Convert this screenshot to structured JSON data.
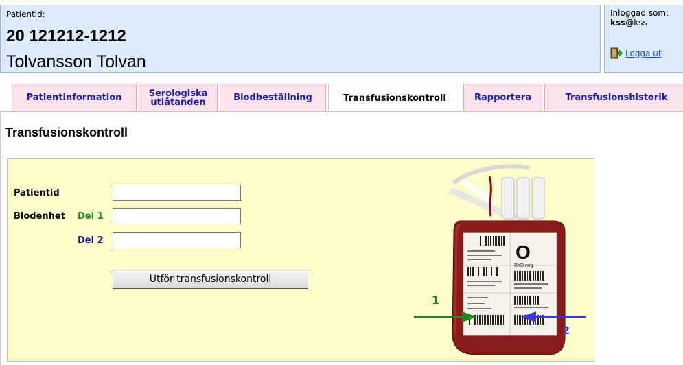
{
  "header": {
    "patient_id_label": "Patientid:",
    "patient_id": "20 121212-1212",
    "patient_name": "Tolvansson Tolvan",
    "login_label": "Inloggad som:",
    "login_user_bold": "kss",
    "login_user_domain": "@kss",
    "logout_link": "Logga ut",
    "logout_icon": "exit-door-icon"
  },
  "tabs": [
    {
      "label": "Patientinformation",
      "active": false
    },
    {
      "label": "Serologiska\nutlåtanden",
      "active": false
    },
    {
      "label": "Blodbeställning",
      "active": false
    },
    {
      "label": "Transfusionskontroll",
      "active": true
    },
    {
      "label": "Rapportera",
      "active": false
    },
    {
      "label": "Transfusionshistorik",
      "active": false
    }
  ],
  "main": {
    "title": "Transfusionskontroll",
    "form": {
      "patient_id_label": "Patientid",
      "patient_id_value": "",
      "blood_unit_label": "Blodenhet",
      "part1_label": "Del 1",
      "part1_value": "",
      "part2_label": "Del 2",
      "part2_value": "",
      "submit_label": "Utför transfusionskontroll"
    },
    "bag_image": {
      "blood_group": "O",
      "rh": "RhD neg",
      "arrow1_label": "1",
      "arrow2_label": "2",
      "arrow1_color": "#1f8a1f",
      "arrow2_color": "#3a3ad6"
    }
  },
  "colors": {
    "header_bg": "#dcecfa",
    "tab_bg": "#fbe3ee",
    "tab_text": "#1a1ab8",
    "panel_bg": "#fdfdcc"
  }
}
